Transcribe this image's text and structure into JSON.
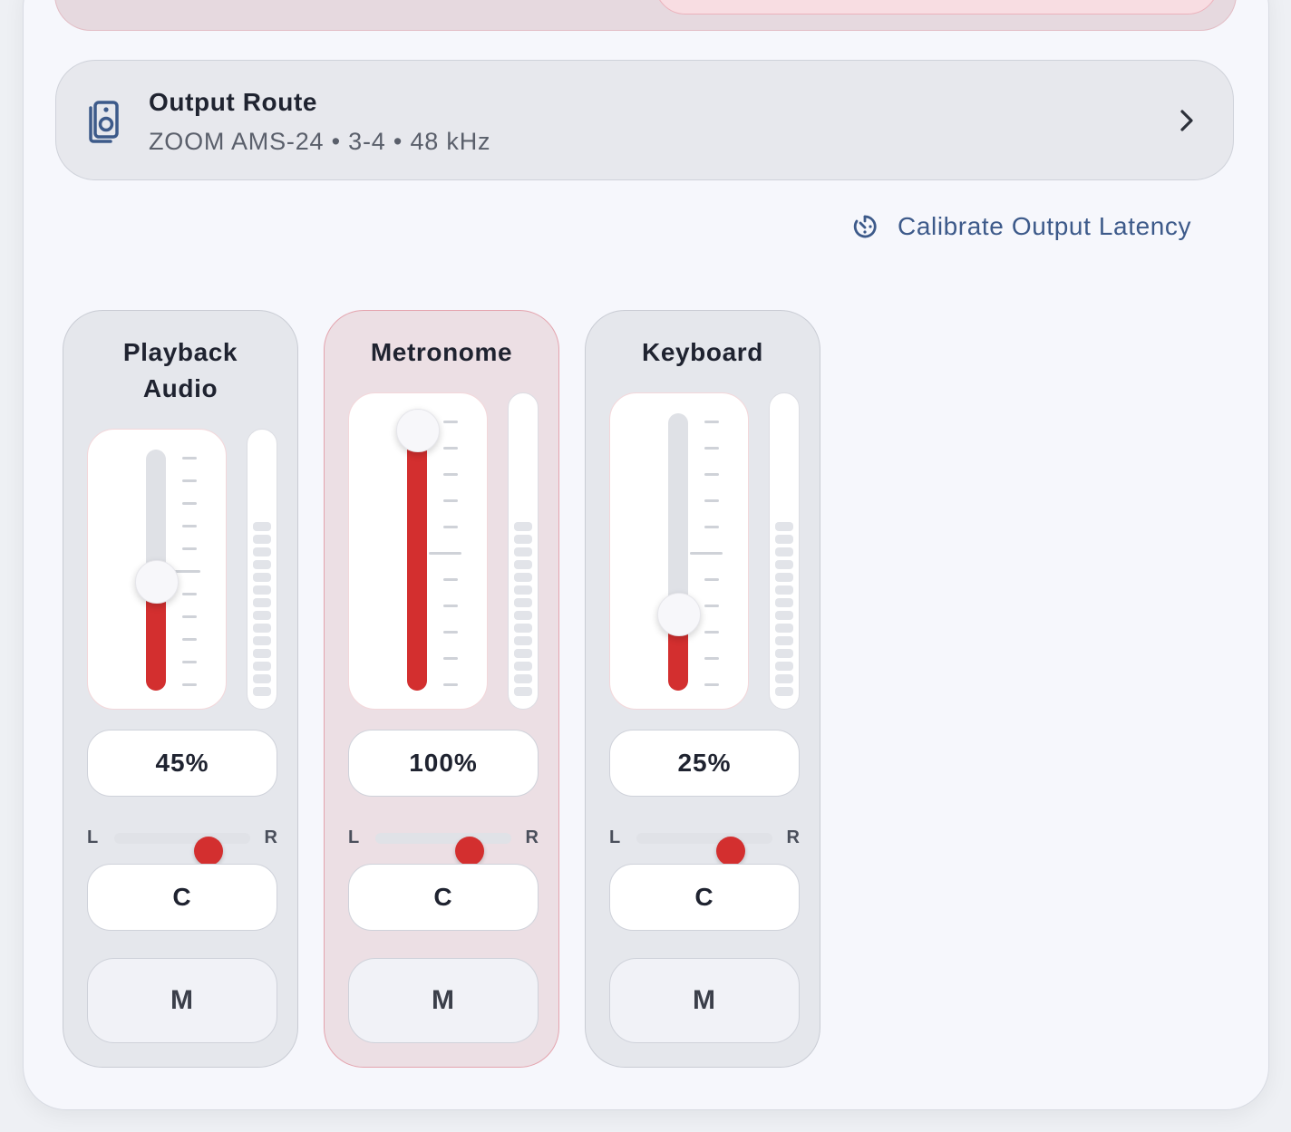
{
  "output_route": {
    "title": "Output Route",
    "subtitle": "ZOOM AMS-24 • 3-4 • 48 kHz"
  },
  "calibrate": {
    "label": "Calibrate Output Latency"
  },
  "colors": {
    "accent": "#d32f2f",
    "link": "#3d5a8a",
    "active_strip_border": "#e4a4ae"
  },
  "icons": [
    "speaker-icon",
    "chevron-right-icon",
    "stopwatch-icon"
  ],
  "channels": [
    {
      "name": "Playback Audio",
      "level": 45,
      "level_label": "45%",
      "pan_label": "C",
      "pan_left": "L",
      "pan_right": "R",
      "mute_label": "M",
      "active": false
    },
    {
      "name": "Metronome",
      "level": 100,
      "level_label": "100%",
      "pan_label": "C",
      "pan_left": "L",
      "pan_right": "R",
      "mute_label": "M",
      "active": true
    },
    {
      "name": "Keyboard",
      "level": 25,
      "level_label": "25%",
      "pan_label": "C",
      "pan_left": "L",
      "pan_right": "R",
      "mute_label": "M",
      "active": false
    }
  ]
}
